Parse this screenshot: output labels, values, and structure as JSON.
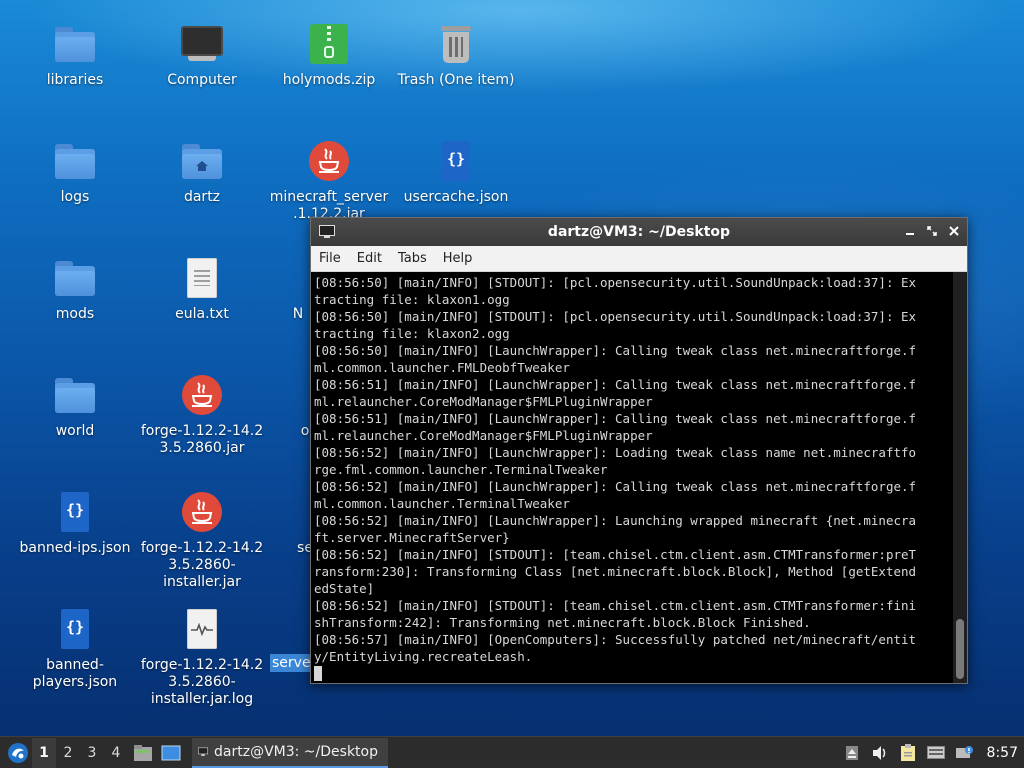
{
  "desktop": {
    "icons": [
      {
        "label": "libraries",
        "icon": "folder-icon"
      },
      {
        "label": "Computer",
        "icon": "computer-icon"
      },
      {
        "label": "holymods.zip",
        "icon": "zip-archive-icon"
      },
      {
        "label": "Trash (One item)",
        "icon": "trash-icon"
      },
      {
        "label": "logs",
        "icon": "folder-icon"
      },
      {
        "label": "dartz",
        "icon": "home-folder-icon"
      },
      {
        "label": "minecraft_server\n.1.12.2.jar",
        "icon": "java-icon"
      },
      {
        "label": "usercache.json",
        "icon": "json-file-icon"
      },
      {
        "label": "mods",
        "icon": "folder-icon"
      },
      {
        "label": "eula.txt",
        "icon": "text-file-icon"
      },
      {
        "label": "world",
        "icon": "folder-icon"
      },
      {
        "label": "forge-1.12.2-14.2\n3.5.2860.jar",
        "icon": "java-icon"
      },
      {
        "label": "banned-ips.json",
        "icon": "json-file-icon"
      },
      {
        "label": "forge-1.12.2-14.2\n3.5.2860-\ninstaller.jar",
        "icon": "java-icon"
      },
      {
        "label": "banned-\nplayers.json",
        "icon": "json-file-icon"
      },
      {
        "label": "forge-1.12.2-14.2\n3.5.2860-\ninstaller.jar.log",
        "icon": "log-file-icon"
      }
    ],
    "partial_labels": {
      "n": "N",
      "o": "o",
      "se": "se",
      "serve": "serve"
    }
  },
  "terminal": {
    "title": "dartz@VM3: ~/Desktop",
    "menu": [
      "File",
      "Edit",
      "Tabs",
      "Help"
    ],
    "lines": [
      "[08:56:50] [main/INFO] [STDOUT]: [pcl.opensecurity.util.SoundUnpack:load:37]: Ex",
      "tracting file: klaxon1.ogg",
      "[08:56:50] [main/INFO] [STDOUT]: [pcl.opensecurity.util.SoundUnpack:load:37]: Ex",
      "tracting file: klaxon2.ogg",
      "[08:56:50] [main/INFO] [LaunchWrapper]: Calling tweak class net.minecraftforge.f",
      "ml.common.launcher.FMLDeobfTweaker",
      "[08:56:51] [main/INFO] [LaunchWrapper]: Calling tweak class net.minecraftforge.f",
      "ml.relauncher.CoreModManager$FMLPluginWrapper",
      "[08:56:51] [main/INFO] [LaunchWrapper]: Calling tweak class net.minecraftforge.f",
      "ml.relauncher.CoreModManager$FMLPluginWrapper",
      "[08:56:52] [main/INFO] [LaunchWrapper]: Loading tweak class name net.minecraftfo",
      "rge.fml.common.launcher.TerminalTweaker",
      "[08:56:52] [main/INFO] [LaunchWrapper]: Calling tweak class net.minecraftforge.f",
      "ml.common.launcher.TerminalTweaker",
      "[08:56:52] [main/INFO] [LaunchWrapper]: Launching wrapped minecraft {net.minecra",
      "ft.server.MinecraftServer}",
      "[08:56:52] [main/INFO] [STDOUT]: [team.chisel.ctm.client.asm.CTMTransformer:preT",
      "ransform:230]: Transforming Class [net.minecraft.block.Block], Method [getExtend",
      "edState]",
      "[08:56:52] [main/INFO] [STDOUT]: [team.chisel.ctm.client.asm.CTMTransformer:fini",
      "shTransform:242]: Transforming net.minecraft.block.Block Finished.",
      "[08:56:57] [main/INFO] [OpenComputers]: Successfully patched net/minecraft/entit",
      "y/EntityLiving.recreateLeash."
    ]
  },
  "taskbar": {
    "workspaces": [
      "1",
      "2",
      "3",
      "4"
    ],
    "active_workspace": "1",
    "task_label": "dartz@VM3: ~/Desktop",
    "clock": "8:57"
  },
  "colors": {
    "accent": "#5a9be6",
    "folder": "#5b9ee6",
    "java": "#e04a3a",
    "zip": "#3bb24b",
    "json": "#1e65c8"
  }
}
